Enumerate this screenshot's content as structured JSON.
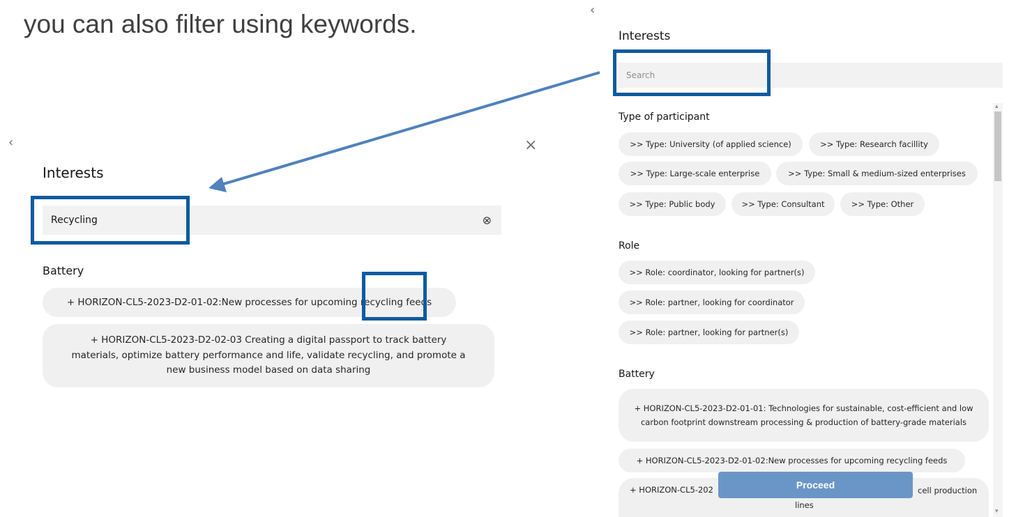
{
  "caption": "you can also filter using keywords.",
  "icons": {
    "back": "‹",
    "close": "×",
    "clear": "⊗",
    "scroll_up": "▴",
    "scroll_down": "▾"
  },
  "left_panel": {
    "title": "Interests",
    "search_value": "Recycling",
    "section_battery": "Battery",
    "chips": [
      "+ HORIZON-CL5-2023-D2-01-02:New processes for upcoming recycling feeds",
      "+ HORIZON-CL5-2023-D2-02-03 Creating a digital passport to track battery materials, optimize battery performance and life, validate recycling, and promote a new business model based on data sharing"
    ]
  },
  "right_panel": {
    "title": "Interests",
    "search_placeholder": "Search",
    "section_type": "Type of participant",
    "type_chips": [
      ">> Type: University (of applied science)",
      ">> Type: Research facillity",
      ">> Type: Large-scale enterprise",
      ">> Type: Small & medium-sized enterprises",
      ">> Type: Public body",
      ">> Type: Consultant",
      ">> Type: Other"
    ],
    "section_role": "Role",
    "role_chips": [
      ">> Role: coordinator, looking for partner(s)",
      ">> Role: partner, looking for coordinator",
      ">> Role: partner, looking for partner(s)"
    ],
    "section_battery": "Battery",
    "battery_chips": [
      "+ HORIZON-CL5-2023-D2-01-01: Technologies for sustainable, cost-efficient and low carbon footprint downstream processing & production of battery-grade materials",
      "+ HORIZON-CL5-2023-D2-01-02:New processes for upcoming recycling feeds",
      "+ HORIZON-CL5-202",
      "cell production",
      "lines"
    ],
    "proceed_label": "Proceed"
  },
  "colors": {
    "highlight_box": "#0e5aa0",
    "arrow": "#4f81bd",
    "proceed_button": "#6a96c7",
    "chip_background": "#f0f0f0"
  }
}
